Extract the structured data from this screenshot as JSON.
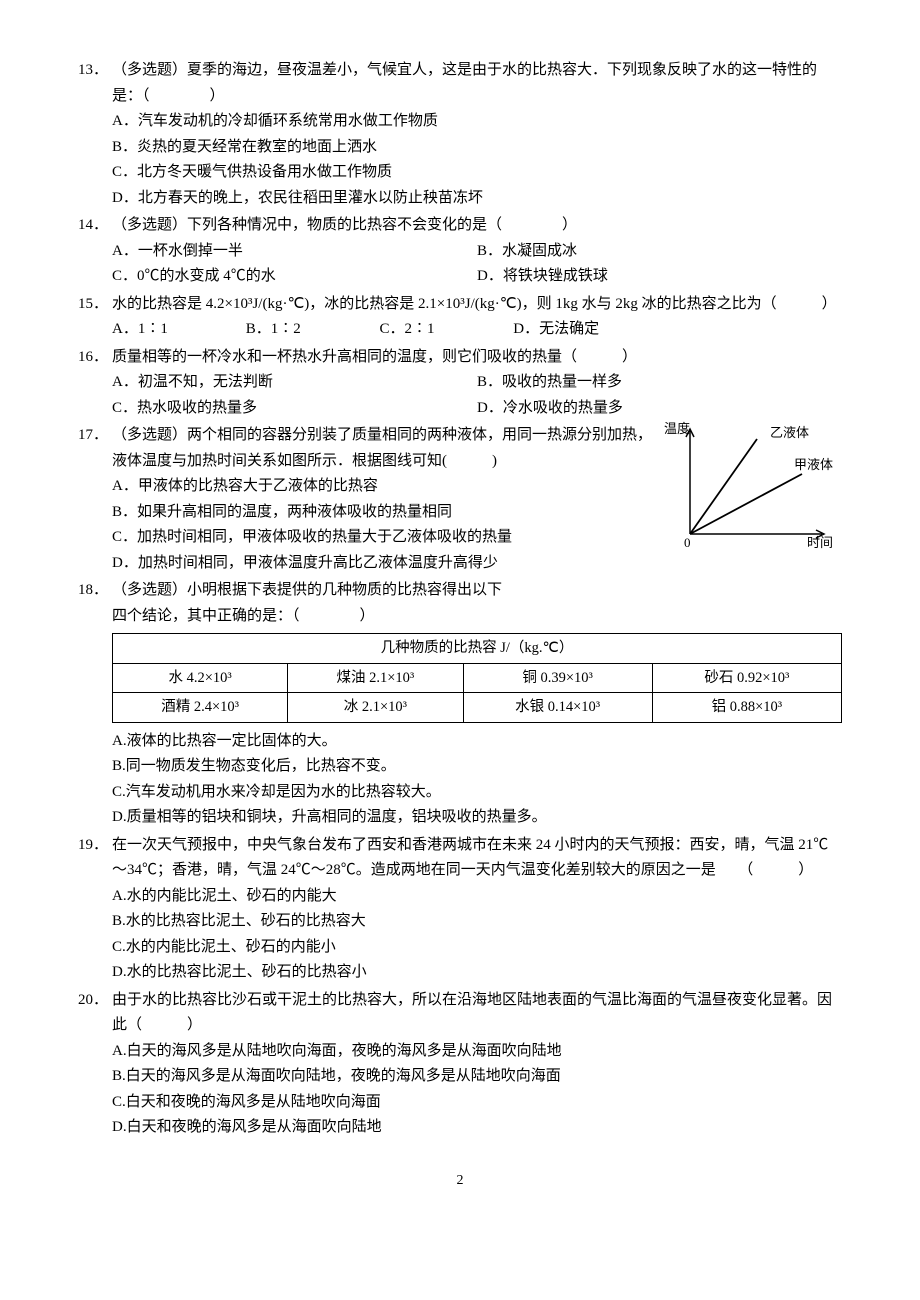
{
  "page_number": "2",
  "graph": {
    "y_axis": "温度",
    "x_axis": "时间",
    "line_top": "乙液体",
    "line_bottom": "甲液体",
    "origin": "0"
  },
  "q13": {
    "num": "13．",
    "stem": "（多选题）夏季的海边，昼夜温差小，气候宜人，这是由于水的比热容大．下列现象反映了水的这一特性的是：（　　　　）",
    "A": "A．汽车发动机的冷却循环系统常用水做工作物质",
    "B": "B．炎热的夏天经常在教室的地面上洒水",
    "C": "C．北方冬天暖气供热设备用水做工作物质",
    "D": "D．北方春天的晚上，农民往稻田里灌水以防止秧苗冻坏"
  },
  "q14": {
    "num": "14．",
    "stem": "（多选题）下列各种情况中，物质的比热容不会变化的是（　　　　）",
    "A": "A．一杯水倒掉一半",
    "B": "B．水凝固成冰",
    "C": "C．0℃的水变成 4℃的水",
    "D": "D．将铁块锉成铁球"
  },
  "q15": {
    "num": "15．",
    "stem": "水的比热容是 4.2×10³J/(kg·℃)，冰的比热容是 2.1×10³J/(kg·℃)，则 1kg 水与 2kg 冰的比热容之比为（　　　）",
    "A": "A．1∶1",
    "B": "B．1∶2",
    "C": "C．2∶1",
    "D": "D．无法确定"
  },
  "q16": {
    "num": "16．",
    "stem": "质量相等的一杯冷水和一杯热水升高相同的温度，则它们吸收的热量（　　　）",
    "A": "A．初温不知，无法判断",
    "B": "B．吸收的热量一样多",
    "C": "C．热水吸收的热量多",
    "D": "D．冷水吸收的热量多"
  },
  "q17": {
    "num": "17．",
    "stem": "（多选题）两个相同的容器分别装了质量相同的两种液体，用同一热源分别加热，液体温度与加热时间关系如图所示．根据图线可知(　　　)",
    "A": "A．甲液体的比热容大于乙液体的比热容",
    "B": "B．如果升高相同的温度，两种液体吸收的热量相同",
    "C": "C．加热时间相同，甲液体吸收的热量大于乙液体吸收的热量",
    "D": "D．加热时间相同，甲液体温度升高比乙液体温度升高得少"
  },
  "q18": {
    "num": "18．",
    "stem1": "（多选题）小明根据下表提供的几种物质的比热容得出以下",
    "stem2": "四个结论，其中正确的是：（　　　　）",
    "table_title": "几种物质的比热容 J/（kg.℃）",
    "r1c1": "水 4.2×10³",
    "r1c2": "煤油 2.1×10³",
    "r1c3": "铜 0.39×10³",
    "r1c4": "砂石 0.92×10³",
    "r2c1": "酒精 2.4×10³",
    "r2c2": "冰 2.1×10³",
    "r2c3": "水银 0.14×10³",
    "r2c4": "铝 0.88×10³",
    "A": "A.液体的比热容一定比固体的大。",
    "B": "B.同一物质发生物态变化后，比热容不变。",
    "C": "C.汽车发动机用水来冷却是因为水的比热容较大。",
    "D": "D.质量相等的铝块和铜块，升高相同的温度，铝块吸收的热量多。"
  },
  "q19": {
    "num": "19．",
    "stem": "在一次天气预报中，中央气象台发布了西安和香港两城市在未来 24 小时内的天气预报：西安，晴，气温 21℃～34℃；香港，晴，气温 24℃～28℃。造成两地在同一天内气温变化差别较大的原因之一是　　（　　　）",
    "A": "A.水的内能比泥土、砂石的内能大",
    "B": "B.水的比热容比泥土、砂石的比热容大",
    "C": "C.水的内能比泥土、砂石的内能小",
    "D": "D.水的比热容比泥土、砂石的比热容小"
  },
  "q20": {
    "num": "20．",
    "stem": "由于水的比热容比沙石或干泥土的比热容大，所以在沿海地区陆地表面的气温比海面的气温昼夜变化显著。因此（　　　）",
    "A": "A.白天的海风多是从陆地吹向海面，夜晚的海风多是从海面吹向陆地",
    "B": "B.白天的海风多是从海面吹向陆地，夜晚的海风多是从陆地吹向海面",
    "C": "C.白天和夜晚的海风多是从陆地吹向海面",
    "D": "D.白天和夜晚的海风多是从海面吹向陆地"
  }
}
